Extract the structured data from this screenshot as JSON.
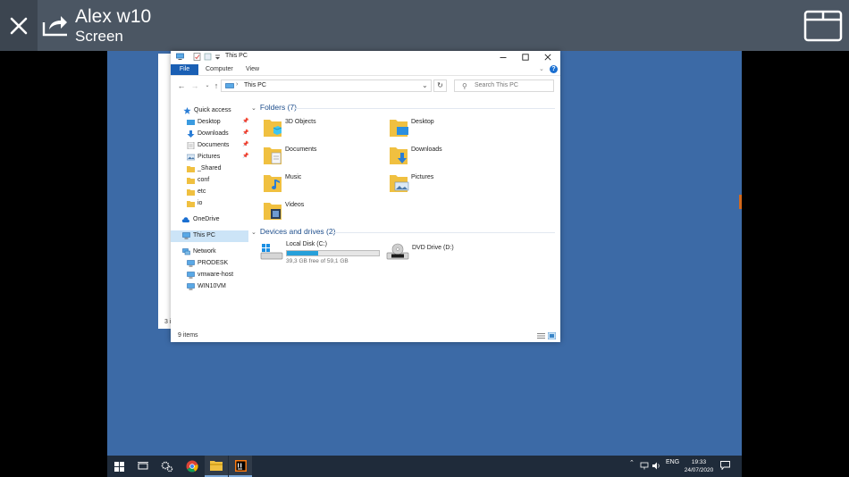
{
  "app_header": {
    "title": "Alex w10",
    "subtitle": "Screen"
  },
  "background_window": {
    "count_fragment": "3 i"
  },
  "explorer": {
    "title": "This PC",
    "ribbon_tabs": [
      "File",
      "Computer",
      "View"
    ],
    "address": {
      "crumb": "This PC"
    },
    "search_placeholder": "Search This PC",
    "nav": {
      "quick_access": "Quick access",
      "quick_items": [
        {
          "label": "Desktop",
          "pinned": true
        },
        {
          "label": "Downloads",
          "pinned": true
        },
        {
          "label": "Documents",
          "pinned": true
        },
        {
          "label": "Pictures",
          "pinned": true
        },
        {
          "label": "_Shared",
          "pinned": false
        },
        {
          "label": "conf",
          "pinned": false
        },
        {
          "label": "etc",
          "pinned": false
        },
        {
          "label": "io",
          "pinned": false
        }
      ],
      "onedrive": "OneDrive",
      "this_pc": "This PC",
      "network": "Network",
      "network_items": [
        "PRODESK",
        "vmware-host",
        "WIN10VM"
      ]
    },
    "folders_group": "Folders (7)",
    "folders": [
      {
        "label": "3D Objects",
        "icon": "folder-3d-objects-icon"
      },
      {
        "label": "Desktop",
        "icon": "folder-desktop-icon"
      },
      {
        "label": "Documents",
        "icon": "folder-documents-icon"
      },
      {
        "label": "Downloads",
        "icon": "folder-downloads-icon"
      },
      {
        "label": "Music",
        "icon": "folder-music-icon"
      },
      {
        "label": "Pictures",
        "icon": "folder-pictures-icon"
      },
      {
        "label": "Videos",
        "icon": "folder-videos-icon"
      }
    ],
    "devices_group": "Devices and drives (2)",
    "drives": [
      {
        "label": "Local Disk (C:)",
        "free_text": "39,3 GB free of 59,1 GB",
        "used_fraction": 0.335
      },
      {
        "label": "DVD Drive (D:)"
      }
    ],
    "status_count": "9 items"
  },
  "taskbar": {
    "language": "ENG",
    "time": "19:33",
    "date": "24/07/2020"
  },
  "colors": {
    "header": "#4b5663",
    "desktop": "#3c6aa6",
    "taskbar": "#1f2b3a",
    "accent": "#1a5fb4",
    "folder": "#f0c040"
  }
}
